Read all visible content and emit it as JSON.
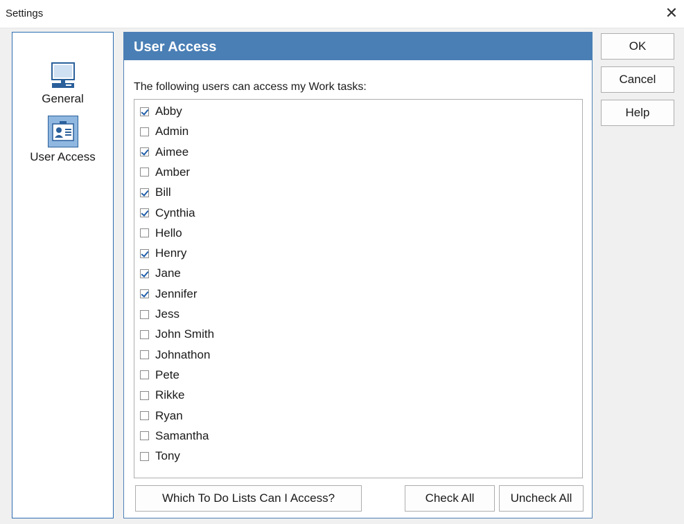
{
  "window": {
    "title": "Settings",
    "close_glyph": "✕"
  },
  "nav": {
    "items": [
      {
        "label": "General",
        "icon": "monitor-icon"
      },
      {
        "label": "User Access",
        "icon": "id-card-icon"
      }
    ],
    "selected": "User Access"
  },
  "panel": {
    "title": "User Access",
    "description": "The following users can access my Work tasks:"
  },
  "users": [
    {
      "name": "Abby",
      "checked": true
    },
    {
      "name": "Admin",
      "checked": false
    },
    {
      "name": "Aimee",
      "checked": true
    },
    {
      "name": "Amber",
      "checked": false
    },
    {
      "name": "Bill",
      "checked": true
    },
    {
      "name": "Cynthia",
      "checked": true
    },
    {
      "name": "Hello",
      "checked": false
    },
    {
      "name": "Henry",
      "checked": true
    },
    {
      "name": "Jane",
      "checked": true
    },
    {
      "name": "Jennifer",
      "checked": true
    },
    {
      "name": "Jess",
      "checked": false
    },
    {
      "name": "John Smith",
      "checked": false
    },
    {
      "name": "Johnathon",
      "checked": false
    },
    {
      "name": "Pete",
      "checked": false
    },
    {
      "name": "Rikke",
      "checked": false
    },
    {
      "name": "Ryan",
      "checked": false
    },
    {
      "name": "Samantha",
      "checked": false
    },
    {
      "name": "Tony",
      "checked": false
    }
  ],
  "buttons": {
    "which_lists": "Which To Do Lists Can I Access?",
    "check_all": "Check All",
    "uncheck_all": "Uncheck All",
    "ok": "OK",
    "cancel": "Cancel",
    "help": "Help"
  },
  "colors": {
    "header_bg": "#4a7fb5",
    "nav_border": "#2c6db0",
    "check_mark": "#1f5da8"
  }
}
